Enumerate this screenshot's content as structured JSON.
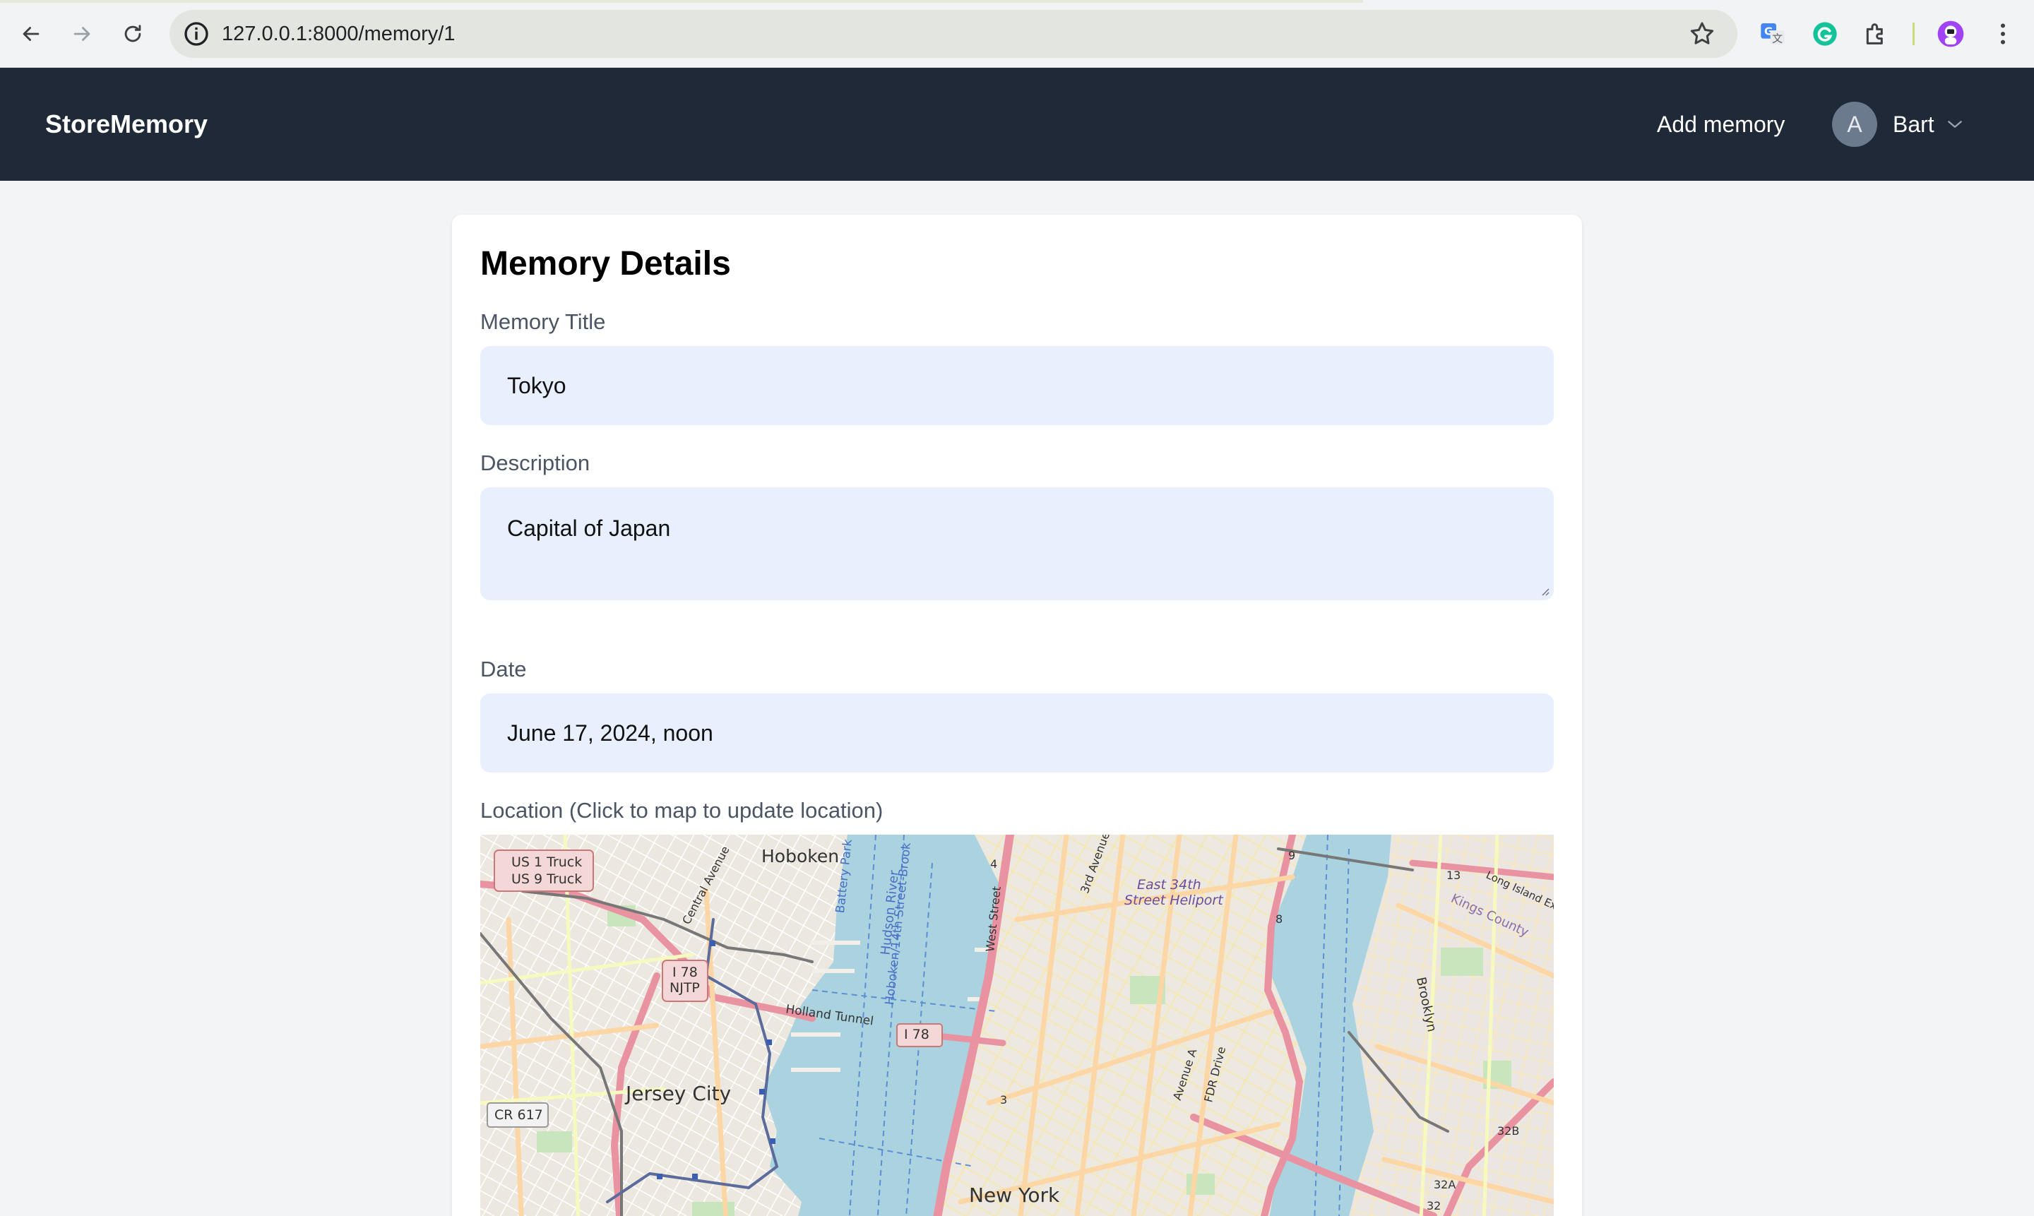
{
  "browser": {
    "url": "127.0.0.1:8000/memory/1"
  },
  "navbar": {
    "brand": "StoreMemory",
    "add_memory": "Add memory",
    "user": {
      "initial": "A",
      "name": "Bart"
    }
  },
  "card": {
    "title": "Memory Details",
    "fields": {
      "title": {
        "label": "Memory Title",
        "value": "Tokyo"
      },
      "description": {
        "label": "Description",
        "value": "Capital of Japan"
      },
      "date": {
        "label": "Date",
        "value": "June 17, 2024, noon"
      },
      "location": {
        "label": "Location (Click to map to update location)"
      }
    }
  },
  "map": {
    "labels": {
      "hoboken": "Hoboken",
      "jersey_city": "Jersey City",
      "new_york": "New York",
      "us1": "US 1 Truck",
      "us9": "US 9 Truck",
      "i78_shield": "I 78",
      "njtp": "NJTP",
      "i78_bridge": "I 78",
      "cr617": "CR 617",
      "holland_tunnel": "Holland Tunnel",
      "east_34th": "East 34th",
      "street_heliport": "Street Heliport",
      "kings_county": "Kings County",
      "brooklyn": "Brooklyn",
      "long_island": "Long Island Ex",
      "fdr_drive": "FDR Drive",
      "west_street": "West Street",
      "third_avenue": "3rd Avenue",
      "avenue_a": "Avenue A",
      "central_avenue": "Central Avenue",
      "hudson_river": "Hudson River",
      "battery_park": "Battery Park City-Midtown",
      "hoboken_14th": "Hoboken/14th Street-Brook",
      "num_4": "4",
      "num_9": "9",
      "num_8": "8",
      "num_3": "3",
      "num_13": "13",
      "num_32b": "32B",
      "num_32a": "32A",
      "num_32": "32"
    }
  },
  "colors": {
    "chrome_bg": "#f1f3f4",
    "navbar_bg": "#1f2937",
    "page_bg": "#f3f4f6",
    "input_bg": "#e8effd",
    "water": "#aad3df"
  }
}
